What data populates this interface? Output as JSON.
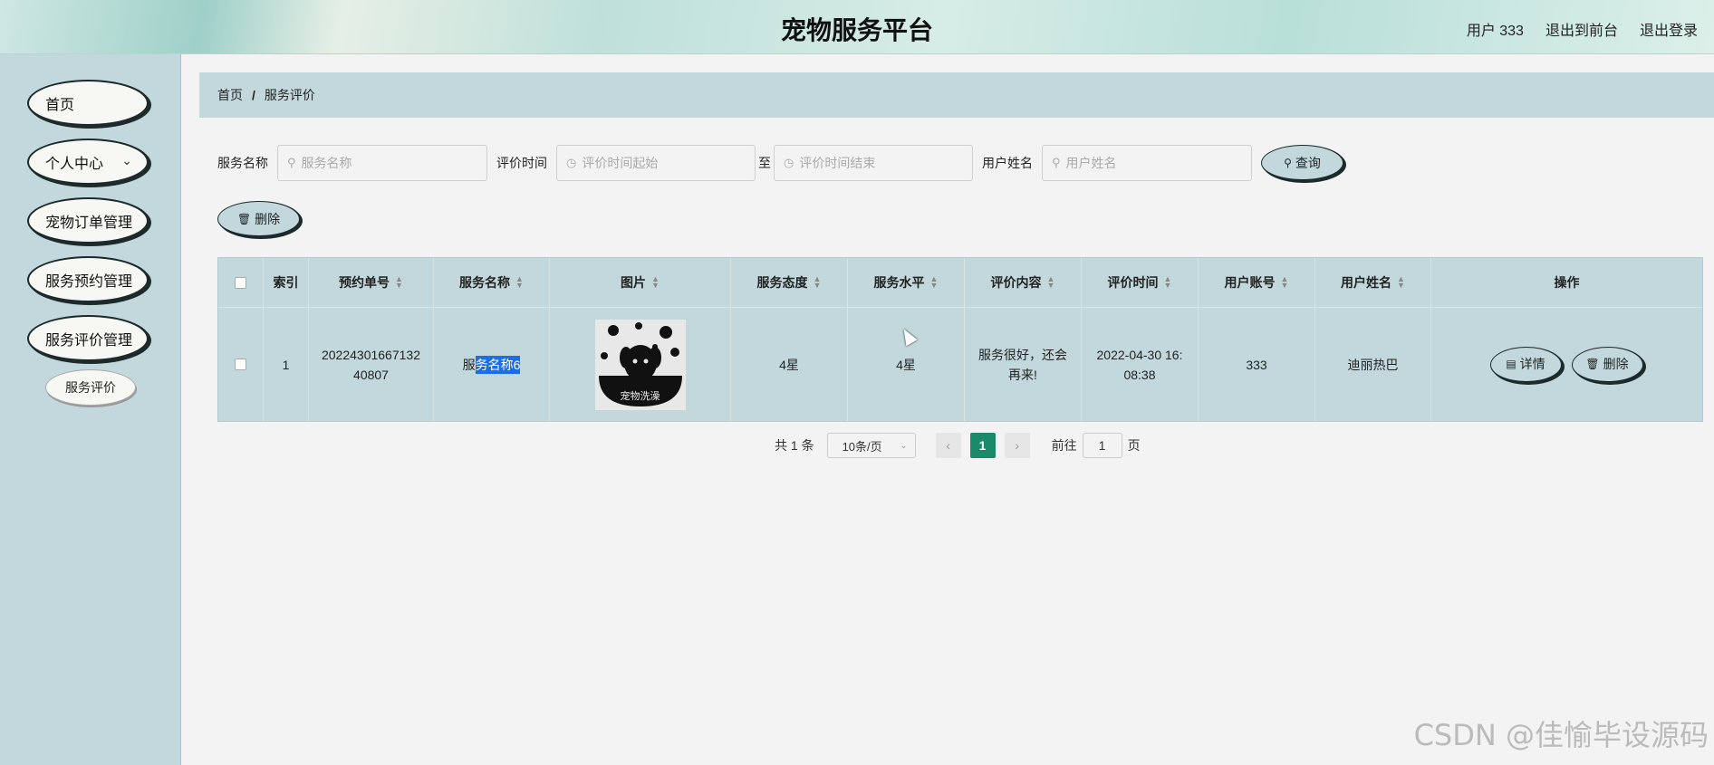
{
  "header": {
    "title": "宠物服务平台",
    "user": "用户 333",
    "exit_front": "退出到前台",
    "logout": "退出登录"
  },
  "sidebar": {
    "items": [
      {
        "label": "首页"
      },
      {
        "label": "个人中心"
      },
      {
        "label": "宠物订单管理"
      },
      {
        "label": "服务预约管理"
      },
      {
        "label": "服务评价管理"
      }
    ],
    "sub_item": "服务评价"
  },
  "breadcrumb": {
    "home": "首页",
    "sep": "/",
    "current": "服务评价"
  },
  "search": {
    "service_name_label": "服务名称",
    "service_name_placeholder": "服务名称",
    "time_label": "评价时间",
    "time_start_placeholder": "评价时间起始",
    "to": "至",
    "time_end_placeholder": "评价时间结束",
    "user_name_label": "用户姓名",
    "user_name_placeholder": "用户姓名",
    "query_button": "查询"
  },
  "toolbar": {
    "delete_button": "删除"
  },
  "table": {
    "headers": [
      "索引",
      "预约单号",
      "服务名称",
      "图片",
      "服务态度",
      "服务水平",
      "评价内容",
      "评价时间",
      "用户账号",
      "用户姓名",
      "操作"
    ],
    "rows": [
      {
        "index": "1",
        "order_no_1": "20224301667132",
        "order_no_2": "40807",
        "service_name_pre": "服",
        "service_name_sel": "务名称6",
        "attitude": "4星",
        "level": "4星",
        "comment_1": "服务很好，还会",
        "comment_2": "再来!",
        "time_1": "2022-04-30 16:",
        "time_2": "08:38",
        "account": "333",
        "user_name": "迪丽热巴",
        "detail_button": "详情",
        "delete_button": "删除",
        "image_caption": "宠物洗澡"
      }
    ]
  },
  "pagination": {
    "total": "共 1 条",
    "page_size": "10条/页",
    "current_page": "1",
    "goto_label": "前往",
    "goto_value": "1",
    "page_unit": "页"
  },
  "watermark": "CSDN @佳愉毕设源码",
  "colors": {
    "sidebar_bg": "#c2d8dc",
    "page_bg": "#f3f3f3",
    "current_page": "#1a8a6a",
    "selection": "#1a6fe8"
  }
}
